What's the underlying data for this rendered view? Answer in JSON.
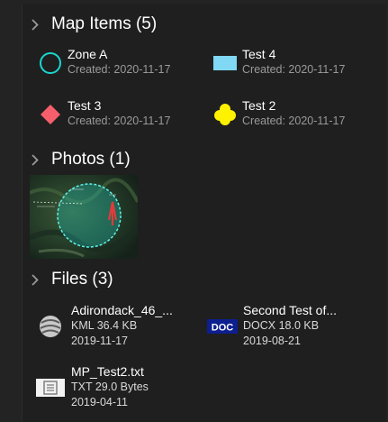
{
  "sections": {
    "map_items": {
      "title": "Map Items (5)"
    },
    "photos": {
      "title": "Photos (1)"
    },
    "files": {
      "title": "Files (3)"
    }
  },
  "map_items": [
    {
      "name": "Zone A",
      "meta": "Created: 2020-11-17",
      "icon": "circle-outline-icon",
      "color": "#19d7cf"
    },
    {
      "name": "Test 4",
      "meta": "Created: 2020-11-17",
      "icon": "rectangle-icon",
      "color": "#80d8f5"
    },
    {
      "name": "Test 3",
      "meta": "Created: 2020-11-17",
      "icon": "diamond-icon",
      "color": "#f55f6c"
    },
    {
      "name": "Test 2",
      "meta": "Created: 2020-11-17",
      "icon": "flower-icon",
      "color": "#fff200"
    }
  ],
  "photos": [
    {
      "icon": "satellite-photo-thumbnail"
    }
  ],
  "files": [
    {
      "name": "Adirondack_46_...",
      "type_size": "KML 36.4 KB",
      "date": "2019-11-17",
      "icon": "kml-globe-icon"
    },
    {
      "name": "Second Test of...",
      "type_size": "DOCX 18.0 KB",
      "date": "2019-08-21",
      "icon": "doc-file-icon",
      "badge": "DOC"
    },
    {
      "name": "MP_Test2.txt",
      "type_size": "TXT 29.0 Bytes",
      "date": "2019-04-11",
      "icon": "txt-file-icon"
    }
  ],
  "colors": {
    "panel_background": "#1f1f1f",
    "outer_background": "#232323",
    "meta_text": "#9a9a9a",
    "accent_teal": "#19d7cf",
    "doc_badge": "#0d1f8f"
  }
}
